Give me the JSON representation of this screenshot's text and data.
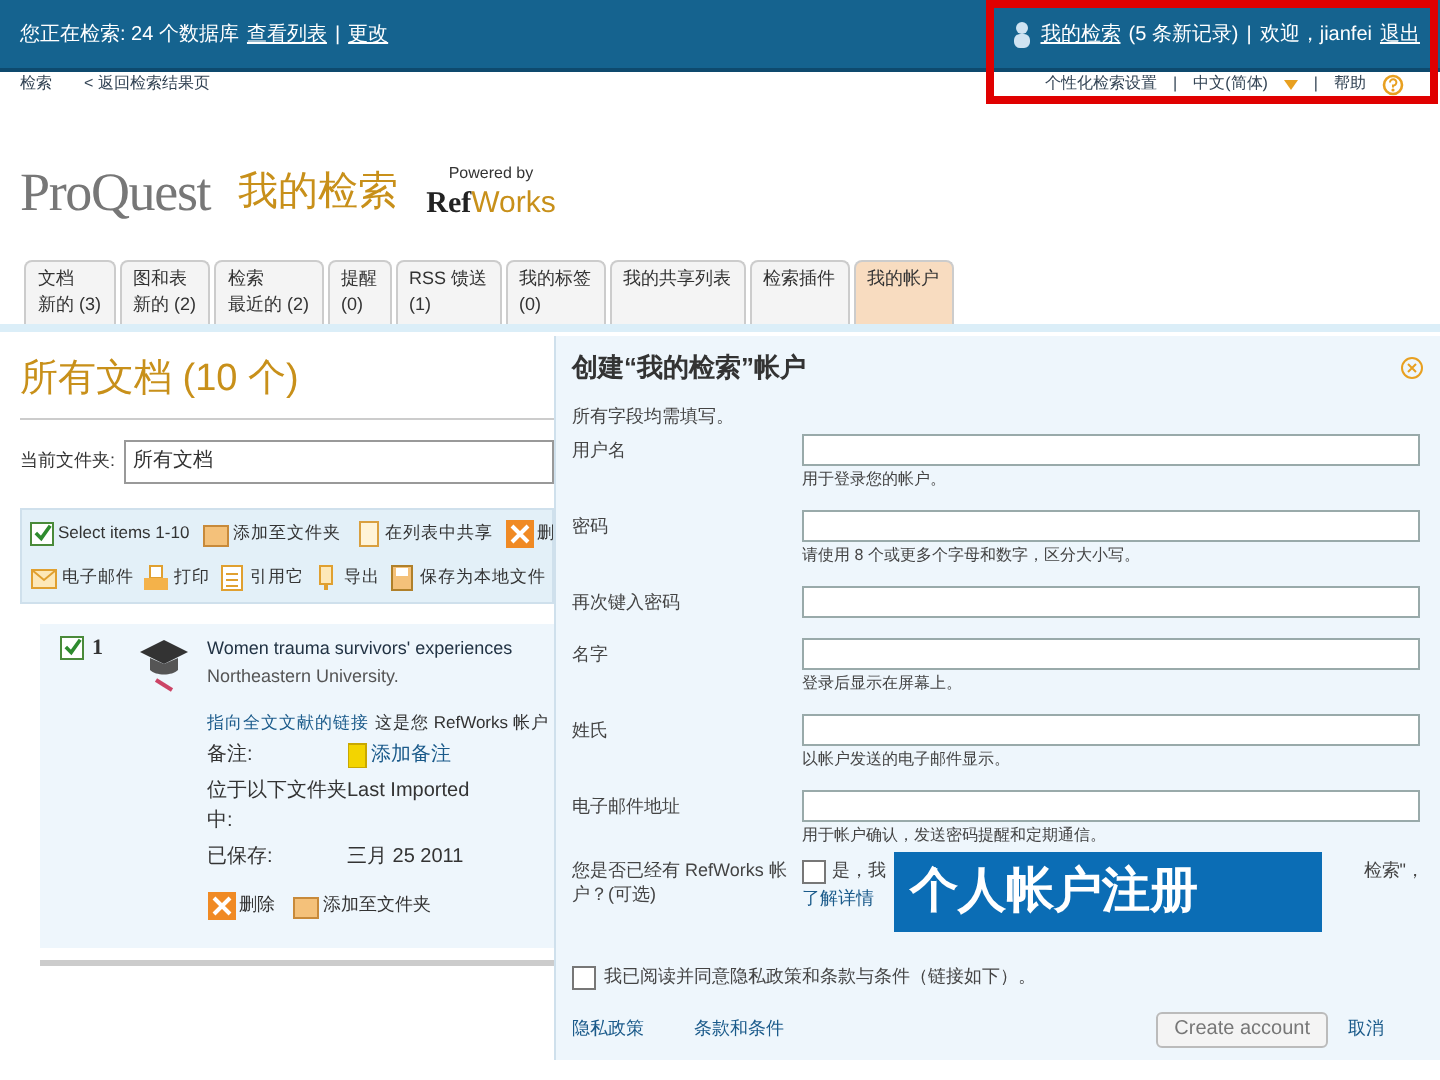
{
  "top_bar": {
    "search_status": "您正在检索: 24 个数据库",
    "view_list": "查看列表",
    "separators": [
      "|",
      "|"
    ],
    "change": "更改",
    "user_link": "我的检索",
    "new_records": "(5 条新记录)",
    "welcome": "欢迎，jianfei",
    "logout": "退出"
  },
  "nav": {
    "search": "检索",
    "back": "< 返回检索结果页",
    "separators": [
      "|",
      "|"
    ],
    "settings": "个性化检索设置",
    "language": "中文(简体)",
    "help": "帮助"
  },
  "logo": {
    "brand": "ProQuest",
    "product": "我的检索",
    "powered_by": "Powered by",
    "refworks_a": "Ref",
    "refworks_b": "Works"
  },
  "tabs": [
    {
      "lines": [
        "文档",
        "新的 (3)"
      ],
      "selected": false
    },
    {
      "lines": [
        "图和表",
        "新的 (2)"
      ],
      "selected": false
    },
    {
      "lines": [
        "检索",
        "最近的 (2)"
      ],
      "selected": false
    },
    {
      "lines": [
        "提醒",
        "(0)"
      ],
      "selected": false
    },
    {
      "lines": [
        "RSS 馈送",
        "(1)"
      ],
      "selected": false
    },
    {
      "lines": [
        "我的标签",
        "(0)"
      ],
      "selected": false
    },
    {
      "lines": [
        "我的共享列表"
      ],
      "selected": false
    },
    {
      "lines": [
        "检索插件"
      ],
      "selected": false
    },
    {
      "lines": [
        "我的帐户"
      ],
      "selected": true
    }
  ],
  "documents": {
    "heading": "所有文档 (10 个)",
    "folder_label": "当前文件夹:",
    "folder_value": "所有文档",
    "toolbar_1": [
      {
        "kind": "checkbox",
        "label": "Select items 1-10",
        "checked": true
      },
      {
        "kind": "folder",
        "label": "添加至文件夹"
      },
      {
        "kind": "share",
        "label": "在列表中共享"
      },
      {
        "kind": "delete",
        "label": "删"
      }
    ],
    "toolbar_2": [
      {
        "kind": "email",
        "label": "电子邮件"
      },
      {
        "kind": "print",
        "label": "打印"
      },
      {
        "kind": "cite",
        "label": "引用它"
      },
      {
        "kind": "export",
        "label": "导出"
      },
      {
        "kind": "save",
        "label": "保存为本地文件"
      }
    ],
    "item": {
      "number": "1",
      "checked": true,
      "title": "Women trauma survivors' experiences",
      "source": "Northeastern University.",
      "fulltext_link": "指向全文文献的链接",
      "account_note": "这是您 RefWorks 帐户",
      "notes_label": "备注:",
      "add_note": "添加备注",
      "folder_label": "位于以下文件夹中:",
      "folder_value": "Last Imported",
      "saved_label": "已保存:",
      "saved_value": "三月 25 2011",
      "delete": "删除",
      "add_folder": "添加至文件夹"
    }
  },
  "dialog": {
    "title": "创建“我的检索”帐户",
    "required_note": "所有字段均需填写。",
    "fields": [
      {
        "label": "用户名",
        "hint": "用于登录您的帐户。"
      },
      {
        "label": "密码",
        "hint": "请使用 8 个或更多个字母和数字，区分大小写。"
      },
      {
        "label": "再次键入密码"
      },
      {
        "label": "名字",
        "hint": "登录后显示在屏幕上。"
      },
      {
        "label": "姓氏",
        "hint": "以帐户发送的电子邮件显示。"
      },
      {
        "label": "电子邮件地址",
        "hint": "用于帐户确认，发送密码提醒和定期通信。"
      }
    ],
    "refworks_label": "您是否已经有 RefWorks 帐户？(可选)",
    "refworks_checked": false,
    "refworks_text": "是，我",
    "refworks_text_end": "检索\"，",
    "learn_more": "了解详情",
    "terms_checked": false,
    "terms_text": "我已阅读并同意隐私政策和条款与条件（链接如下）。",
    "privacy": "隐私政策",
    "terms": "条款和条件",
    "create": "Create account",
    "cancel": "取消"
  },
  "banner": "个人帐户注册"
}
